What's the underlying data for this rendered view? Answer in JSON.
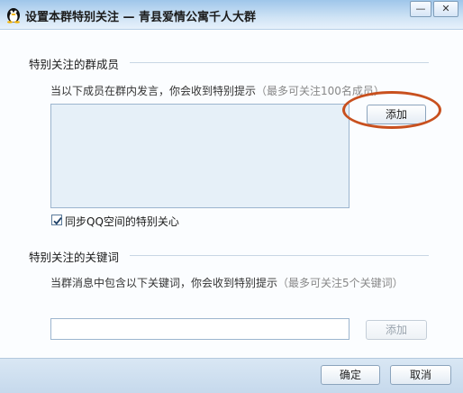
{
  "window": {
    "title": "设置本群特别关注 — 青县爱情公寓千人大群",
    "minimize_label": "—",
    "close_label": "✕"
  },
  "members_section": {
    "label": "特别关注的群成员",
    "hint_main": "当以下成员在群内发言，你会收到特别提示",
    "hint_limit": "（最多可关注100名成员）",
    "add_button": "添加",
    "sync_checkbox_label": "同步QQ空间的特别关心",
    "sync_checked": true
  },
  "keywords_section": {
    "label": "特别关注的关键词",
    "hint_main": "当群消息中包含以下关键词，你会收到特别提示",
    "hint_limit": "（最多可关注5个关键词）",
    "input_value": "",
    "add_button": "添加"
  },
  "footer": {
    "ok_button": "确定",
    "cancel_button": "取消"
  },
  "colors": {
    "highlight_ring": "#c8501e",
    "member_box_bg": "#e6f0f8"
  }
}
